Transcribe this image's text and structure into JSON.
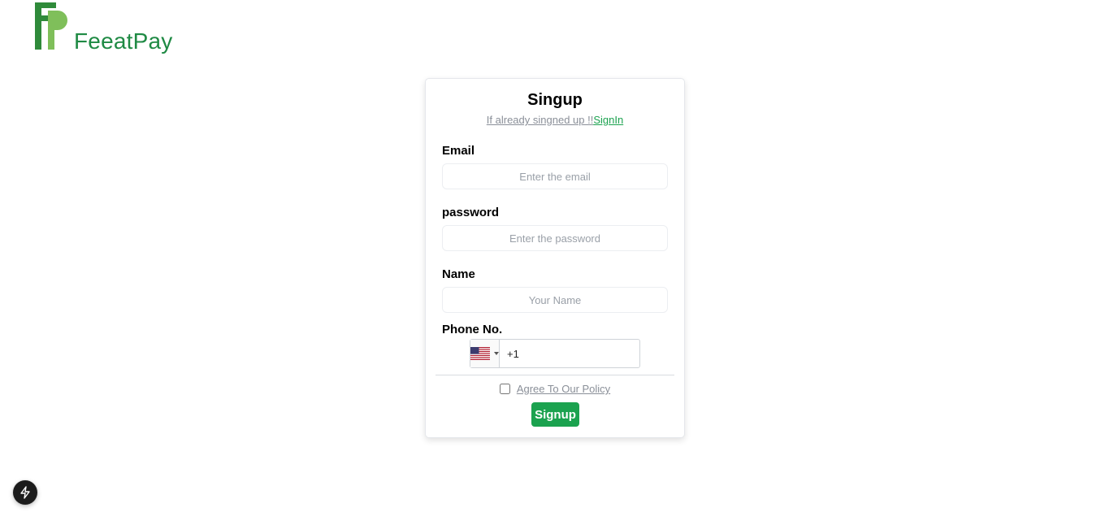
{
  "brand": {
    "name": "FeeatPay",
    "icon": "feeatpay-logo",
    "colors": {
      "text": "#1f8a44",
      "logo_dark": "#2f8a3a",
      "logo_light": "#7fbf5a"
    }
  },
  "form": {
    "title": "Singup",
    "subtitle_text": "If already singned up !!",
    "signin_link": "SignIn",
    "email": {
      "label": "Email",
      "placeholder": "Enter the email",
      "value": ""
    },
    "password": {
      "label": "password",
      "placeholder": "Enter the password",
      "value": ""
    },
    "name": {
      "label": "Name",
      "placeholder": "Your Name",
      "value": ""
    },
    "phone": {
      "label": "Phone No.",
      "country_icon": "us-flag-icon",
      "value": "+1"
    },
    "agree_label": "Agree To Our Policy",
    "agree_checked": false,
    "submit_label": "Signup",
    "accent": "#1ba24f"
  },
  "dev_indicator": {
    "icon": "lightning-bolt-icon"
  }
}
